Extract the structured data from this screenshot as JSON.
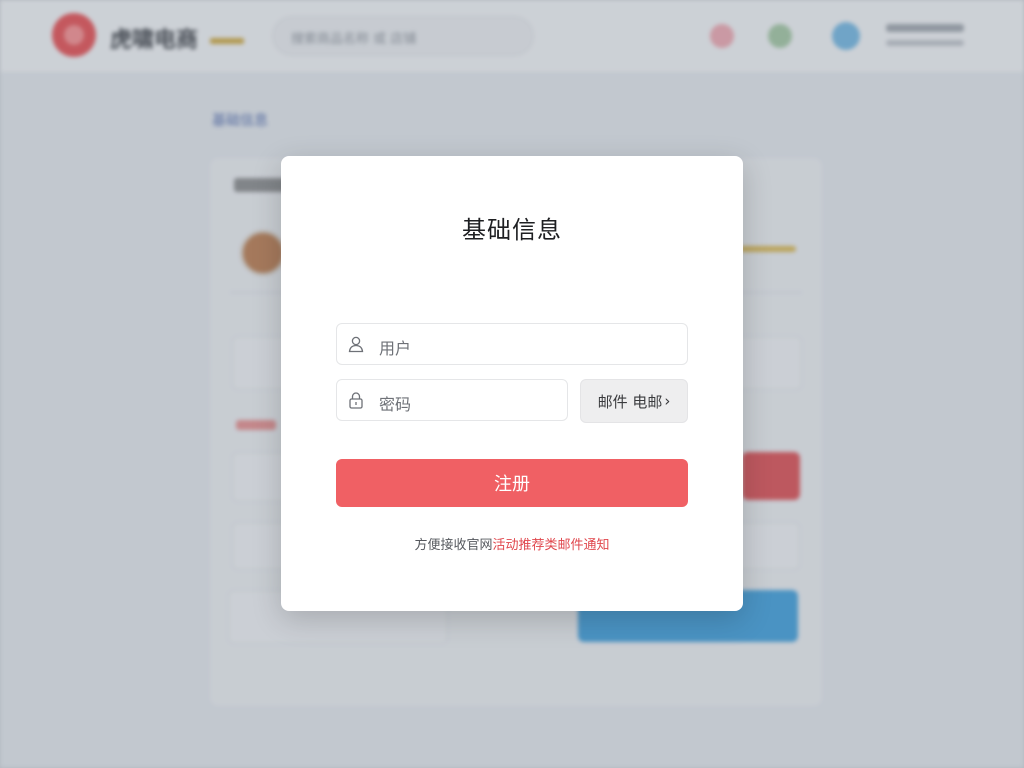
{
  "background": {
    "logo_text": "虎啸电商",
    "search_placeholder": "搜索商品名称 或 店铺",
    "breadcrumb_main": "基础信息",
    "breadcrumb_sub": ""
  },
  "modal": {
    "title": "基础信息",
    "username_placeholder": "用户",
    "password_placeholder": "密码",
    "code_button_label": "邮件 电邮",
    "code_button_chevron": "›",
    "register_label": "注册",
    "notice_plain": "方便接收官网",
    "notice_highlight": "活动推荐类邮件通知"
  },
  "colors": {
    "primary": "#f06064",
    "highlight_text": "#e0464c",
    "brand_logo": "#e2494d"
  },
  "icons": {
    "username": "user-icon",
    "password": "lock-icon",
    "code_button": "chevron-right-icon"
  }
}
